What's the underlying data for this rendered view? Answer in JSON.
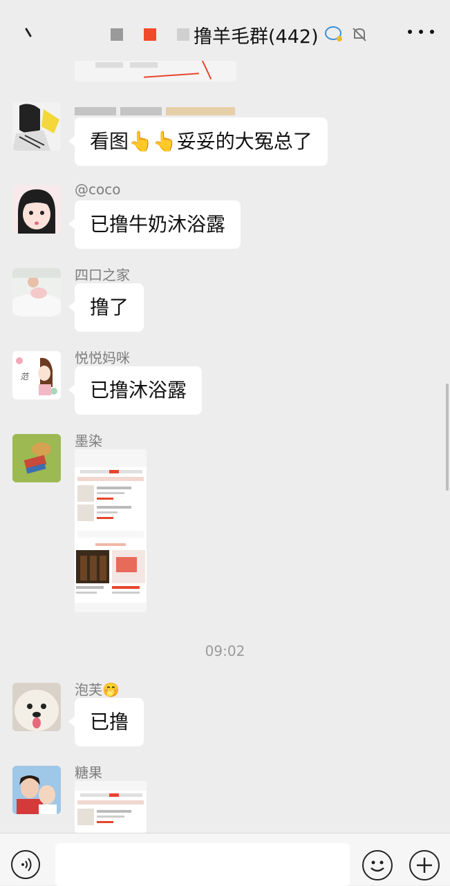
{
  "header": {
    "title": "撸羊毛群(442)"
  },
  "messages": [
    {
      "sender": "",
      "text": "看图👆👆妥妥的大冤总了"
    },
    {
      "sender": "@coco",
      "text": "已撸牛奶沐浴露"
    },
    {
      "sender": "四口之家",
      "text": "撸了"
    },
    {
      "sender": "悦悦妈咪",
      "text": "已撸沐浴露"
    },
    {
      "sender": "墨染",
      "text": ""
    },
    {
      "sender": "泡芙🤭",
      "text": "已撸"
    },
    {
      "sender": "糖果",
      "text": ""
    }
  ],
  "timestamp": "09:02",
  "avatar_badges": {
    "yueyue": "范"
  },
  "colors": {
    "background": "#ededed",
    "bubble": "#ffffff",
    "accent": "#e8452c",
    "sender_text": "#7d7d7d"
  },
  "icons": {
    "back": "back-chevron-icon",
    "more": "more-dots-icon",
    "voice": "voice-input-icon",
    "emoji": "emoji-icon",
    "plus": "plus-icon",
    "mute": "mute-bell-icon",
    "group_chat": "group-chat-icon"
  }
}
